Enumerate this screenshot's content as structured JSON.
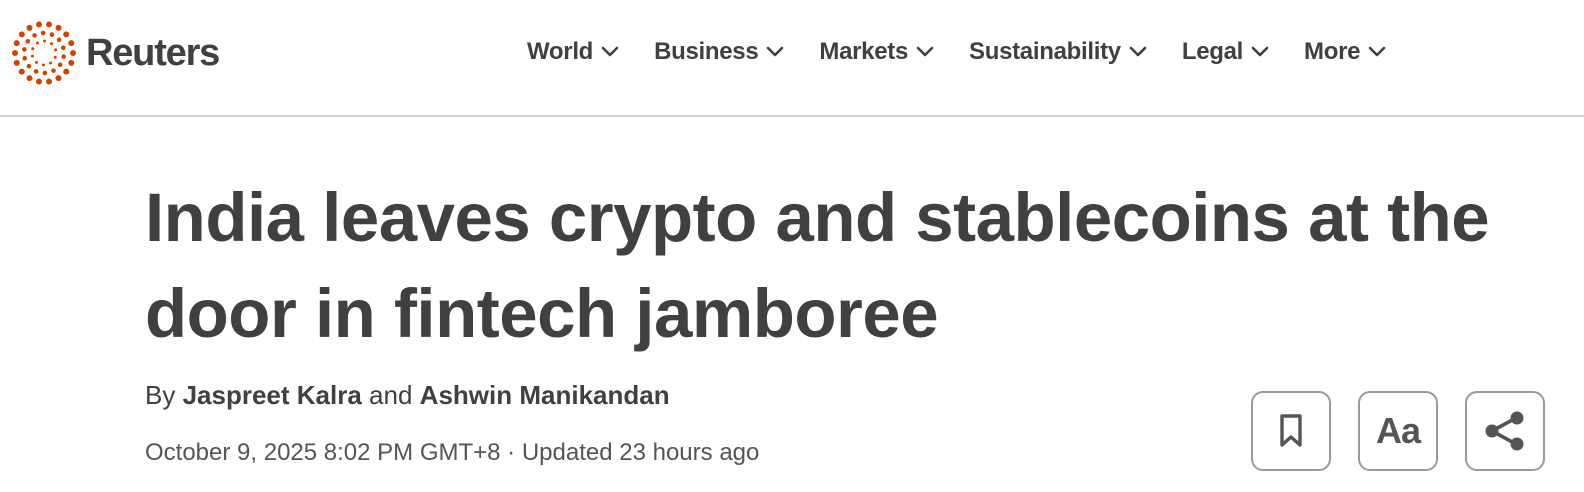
{
  "brand": {
    "name": "Reuters",
    "accent": "#d64000"
  },
  "nav": {
    "items": [
      {
        "label": "World",
        "icon": "chevron-down-icon"
      },
      {
        "label": "Business",
        "icon": "chevron-down-icon"
      },
      {
        "label": "Markets",
        "icon": "chevron-down-icon"
      },
      {
        "label": "Sustainability",
        "icon": "chevron-down-icon"
      },
      {
        "label": "Legal",
        "icon": "chevron-down-icon"
      },
      {
        "label": "More",
        "icon": "chevron-down-icon"
      }
    ]
  },
  "article": {
    "headline": "India leaves crypto and stablecoins at the door in fintech jamboree",
    "byline": {
      "prefix": "By",
      "author1": "Jaspreet Kalra",
      "conjunction": "and",
      "author2": "Ashwin Manikandan"
    },
    "dateline": "October 9, 2025 8:02 PM GMT+8 · Updated 23 hours ago"
  },
  "tools": {
    "save_icon": "bookmark-icon",
    "text_size_label": "Aa",
    "share_icon": "share-icon"
  }
}
